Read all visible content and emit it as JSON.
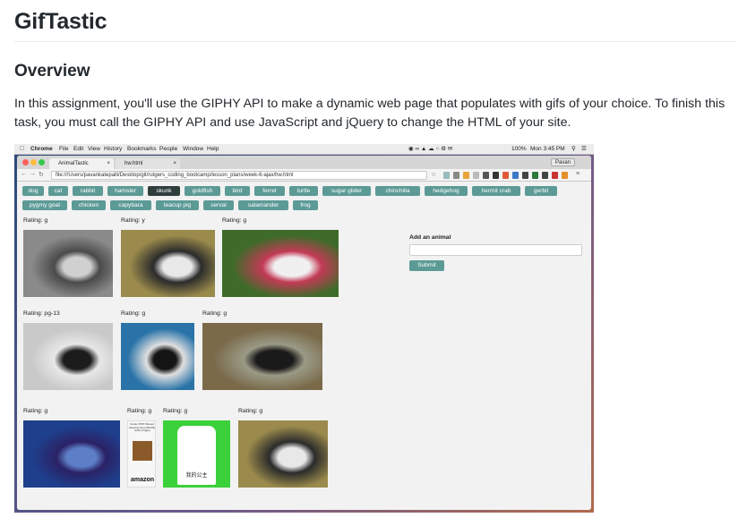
{
  "doc": {
    "title": "GifTastic",
    "overview_heading": "Overview",
    "paragraph": "In this assignment, you'll use the GIPHY API to make a dynamic web page that populates with gifs of your choice. To finish this task, you must call the GIPHY API and use JavaScript and jQuery to change the HTML of your site."
  },
  "screenshot": {
    "menubar": {
      "app": "Chrome",
      "items": [
        "File",
        "Edit",
        "View",
        "History",
        "Bookmarks",
        "People",
        "Window",
        "Help"
      ],
      "battery": "100%",
      "clock": "Mon 3:45 PM"
    },
    "tabs": [
      {
        "label": "AnimalTastic"
      },
      {
        "label": "hw.html"
      }
    ],
    "profile": "Pavan",
    "url": "file:///Users/pavankatepalli/Desktop/git/rutgers_coding_bootcamp/lesson_plans/week-6-ajax/hw.html",
    "buttons_row1": [
      "dog",
      "cat",
      "rabbit",
      "hamster",
      "skunk",
      "goldfish",
      "bird",
      "ferret",
      "turtle",
      "sugar glider",
      "chinchilla",
      "hedgehog",
      "hermit crab",
      "gerbil"
    ],
    "buttons_row2": [
      "pygmy goat",
      "chicken",
      "capybara",
      "teacup pig",
      "serval",
      "salamander",
      "frog"
    ],
    "active_button": "skunk",
    "form": {
      "label": "Add an animal",
      "input_value": "",
      "submit_label": "Submit"
    },
    "gifs": [
      {
        "rating": "Rating: g",
        "palette": [
          "#8a8a8a",
          "#d0d0d0",
          "#4a4a4a"
        ]
      },
      {
        "rating": "Rating: y",
        "palette": [
          "#9a8a4c",
          "#e8e8e8",
          "#2b2b2b"
        ]
      },
      {
        "rating": "Rating: g",
        "palette": [
          "#3f6b2a",
          "#f0f0f0",
          "#c23a55"
        ]
      },
      {
        "rating": "Rating: pg-13",
        "palette": [
          "#c9c9c9",
          "#1c1c1c",
          "#e7e7e7"
        ]
      },
      {
        "rating": "Rating: g",
        "palette": [
          "#2a73a8",
          "#141414",
          "#e0e0e0"
        ]
      },
      {
        "rating": "Rating: g",
        "palette": [
          "#7a6a4a",
          "#1a1a1a",
          "#9a9a86"
        ]
      },
      {
        "rating": "Rating: g",
        "palette": [
          "#1e3f8c",
          "#5d7fc7",
          "#2b2266"
        ]
      },
      {
        "rating": "Rating: g",
        "palette": [
          "#f7f7f7",
          "#a0522d",
          "#2b2b2b"
        ]
      },
      {
        "rating": "Rating: g",
        "palette": [
          "#3ad13a",
          "#ffffff",
          "#222222"
        ]
      },
      {
        "rating": "Rating: g",
        "palette": [
          "#9a8a4c",
          "#e8e8e8",
          "#2b2b2b"
        ]
      }
    ],
    "amazon_card": {
      "caption": "Funko POP! Marvel: Dancing Groot Bobble Action Figure",
      "brand": "amazon"
    },
    "shirt_caption": "我的公主"
  }
}
